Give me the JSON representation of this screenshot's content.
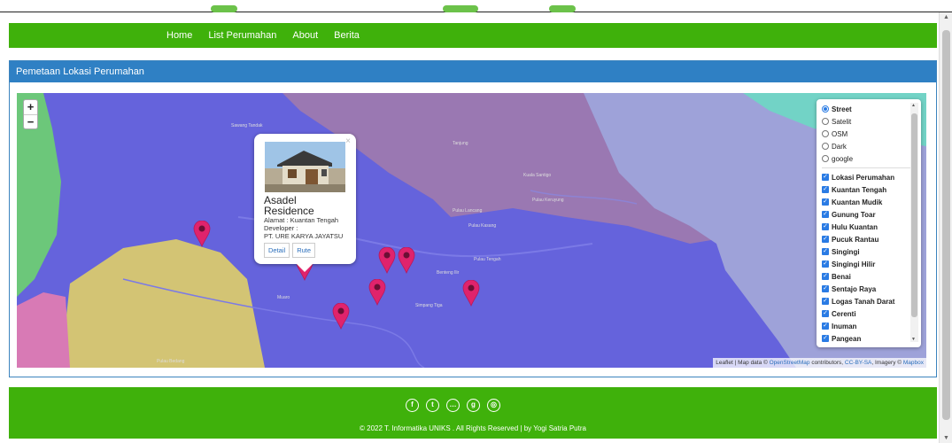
{
  "nav": {
    "items": [
      "Home",
      "List Perumahan",
      "About",
      "Berita"
    ]
  },
  "panel": {
    "title": "Pemetaan Lokasi Perumahan"
  },
  "map": {
    "zoom_in": "+",
    "zoom_out": "−",
    "labels": [
      "Sawang Tandak",
      "Tanjung",
      "Kuala Santigo",
      "Pulau Lancang",
      "Pulau Keruyung",
      "Pulau Kasang",
      "Pulau Tengah",
      "Benteng Ilir",
      "Simpang Tiga",
      "Muaro",
      "Pulau Bedang"
    ],
    "popup": {
      "title": "Asadel Residence",
      "address": "Alamat : Kuantan Tengah",
      "developer_label": "Developer :",
      "developer": "PT. URE KARYA JAYATSU",
      "detail_button": "Detail",
      "route_button": "Rute",
      "close": "×"
    },
    "marker_color": "#e0236c",
    "attribution": {
      "prefix": "Leaflet | Map data © ",
      "osm": "OpenStreetMap",
      "mid": " contributors, ",
      "license": "CC-BY-SA",
      "imagery": ", Imagery © ",
      "mapbox": "Mapbox"
    }
  },
  "layers": {
    "base": [
      {
        "label": "Street",
        "selected": true
      },
      {
        "label": "Satelit",
        "selected": false
      },
      {
        "label": "OSM",
        "selected": false
      },
      {
        "label": "Dark",
        "selected": false
      },
      {
        "label": "google",
        "selected": false
      }
    ],
    "overlays": [
      "Lokasi Perumahan",
      "Kuantan Tengah",
      "Kuantan Mudik",
      "Gunung Toar",
      "Hulu Kuantan",
      "Pucuk Rantau",
      "Singingi",
      "Singingi Hilir",
      "Benai",
      "Sentajo Raya",
      "Logas Tanah Darat",
      "Cerenti",
      "Inuman",
      "Pangean"
    ]
  },
  "footer": {
    "social_icons": [
      "facebook-icon",
      "twitter-icon",
      "ellipsis-icon",
      "google-plus-icon",
      "dribbble-icon"
    ],
    "copyright": "© 2022 T. Informatika UNIKS . All Rights Reserved | by Yogi Satria Putra"
  },
  "colors": {
    "nav_green": "#3fb10b",
    "panel_blue": "#2f80c4",
    "map_purple": "#6563dc",
    "region_mauve": "#9a78b2",
    "region_lavender": "#9ea2d9",
    "region_teal": "#72d3c6",
    "region_green": "#6cc77a",
    "region_yellow": "#d3c474",
    "region_pink": "#d87ab5"
  }
}
